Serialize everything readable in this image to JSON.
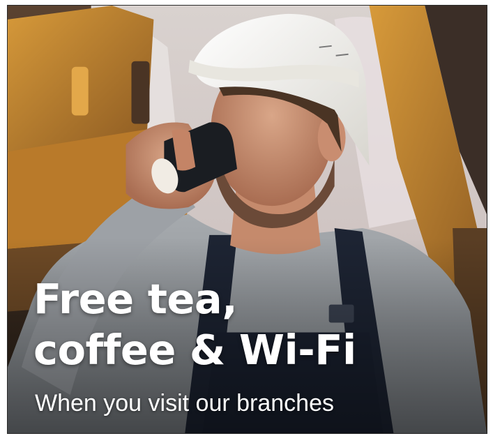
{
  "promo": {
    "headline_line1": "Free tea,",
    "headline_line2": "coffee & Wi-Fi",
    "subline": "When you visit our branches"
  },
  "palette": {
    "background": "#ffffff",
    "text": "#ffffff",
    "excavator": "#c98a2e",
    "helmet": "#f2f0ea",
    "sweater": "#9a9ea3",
    "overalls": "#1d2433",
    "cup": "#1a1d22"
  }
}
